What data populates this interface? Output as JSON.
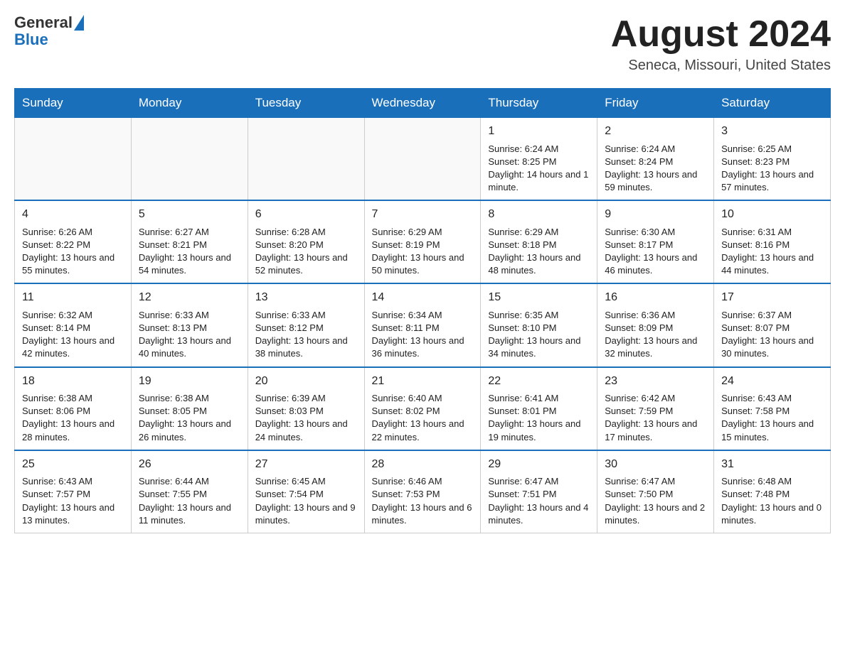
{
  "logo": {
    "text_general": "General",
    "text_blue": "Blue"
  },
  "header": {
    "month_year": "August 2024",
    "location": "Seneca, Missouri, United States"
  },
  "days_of_week": [
    "Sunday",
    "Monday",
    "Tuesday",
    "Wednesday",
    "Thursday",
    "Friday",
    "Saturday"
  ],
  "weeks": [
    {
      "days": [
        {
          "num": "",
          "info": ""
        },
        {
          "num": "",
          "info": ""
        },
        {
          "num": "",
          "info": ""
        },
        {
          "num": "",
          "info": ""
        },
        {
          "num": "1",
          "info": "Sunrise: 6:24 AM\nSunset: 8:25 PM\nDaylight: 14 hours and 1 minute."
        },
        {
          "num": "2",
          "info": "Sunrise: 6:24 AM\nSunset: 8:24 PM\nDaylight: 13 hours and 59 minutes."
        },
        {
          "num": "3",
          "info": "Sunrise: 6:25 AM\nSunset: 8:23 PM\nDaylight: 13 hours and 57 minutes."
        }
      ]
    },
    {
      "days": [
        {
          "num": "4",
          "info": "Sunrise: 6:26 AM\nSunset: 8:22 PM\nDaylight: 13 hours and 55 minutes."
        },
        {
          "num": "5",
          "info": "Sunrise: 6:27 AM\nSunset: 8:21 PM\nDaylight: 13 hours and 54 minutes."
        },
        {
          "num": "6",
          "info": "Sunrise: 6:28 AM\nSunset: 8:20 PM\nDaylight: 13 hours and 52 minutes."
        },
        {
          "num": "7",
          "info": "Sunrise: 6:29 AM\nSunset: 8:19 PM\nDaylight: 13 hours and 50 minutes."
        },
        {
          "num": "8",
          "info": "Sunrise: 6:29 AM\nSunset: 8:18 PM\nDaylight: 13 hours and 48 minutes."
        },
        {
          "num": "9",
          "info": "Sunrise: 6:30 AM\nSunset: 8:17 PM\nDaylight: 13 hours and 46 minutes."
        },
        {
          "num": "10",
          "info": "Sunrise: 6:31 AM\nSunset: 8:16 PM\nDaylight: 13 hours and 44 minutes."
        }
      ]
    },
    {
      "days": [
        {
          "num": "11",
          "info": "Sunrise: 6:32 AM\nSunset: 8:14 PM\nDaylight: 13 hours and 42 minutes."
        },
        {
          "num": "12",
          "info": "Sunrise: 6:33 AM\nSunset: 8:13 PM\nDaylight: 13 hours and 40 minutes."
        },
        {
          "num": "13",
          "info": "Sunrise: 6:33 AM\nSunset: 8:12 PM\nDaylight: 13 hours and 38 minutes."
        },
        {
          "num": "14",
          "info": "Sunrise: 6:34 AM\nSunset: 8:11 PM\nDaylight: 13 hours and 36 minutes."
        },
        {
          "num": "15",
          "info": "Sunrise: 6:35 AM\nSunset: 8:10 PM\nDaylight: 13 hours and 34 minutes."
        },
        {
          "num": "16",
          "info": "Sunrise: 6:36 AM\nSunset: 8:09 PM\nDaylight: 13 hours and 32 minutes."
        },
        {
          "num": "17",
          "info": "Sunrise: 6:37 AM\nSunset: 8:07 PM\nDaylight: 13 hours and 30 minutes."
        }
      ]
    },
    {
      "days": [
        {
          "num": "18",
          "info": "Sunrise: 6:38 AM\nSunset: 8:06 PM\nDaylight: 13 hours and 28 minutes."
        },
        {
          "num": "19",
          "info": "Sunrise: 6:38 AM\nSunset: 8:05 PM\nDaylight: 13 hours and 26 minutes."
        },
        {
          "num": "20",
          "info": "Sunrise: 6:39 AM\nSunset: 8:03 PM\nDaylight: 13 hours and 24 minutes."
        },
        {
          "num": "21",
          "info": "Sunrise: 6:40 AM\nSunset: 8:02 PM\nDaylight: 13 hours and 22 minutes."
        },
        {
          "num": "22",
          "info": "Sunrise: 6:41 AM\nSunset: 8:01 PM\nDaylight: 13 hours and 19 minutes."
        },
        {
          "num": "23",
          "info": "Sunrise: 6:42 AM\nSunset: 7:59 PM\nDaylight: 13 hours and 17 minutes."
        },
        {
          "num": "24",
          "info": "Sunrise: 6:43 AM\nSunset: 7:58 PM\nDaylight: 13 hours and 15 minutes."
        }
      ]
    },
    {
      "days": [
        {
          "num": "25",
          "info": "Sunrise: 6:43 AM\nSunset: 7:57 PM\nDaylight: 13 hours and 13 minutes."
        },
        {
          "num": "26",
          "info": "Sunrise: 6:44 AM\nSunset: 7:55 PM\nDaylight: 13 hours and 11 minutes."
        },
        {
          "num": "27",
          "info": "Sunrise: 6:45 AM\nSunset: 7:54 PM\nDaylight: 13 hours and 9 minutes."
        },
        {
          "num": "28",
          "info": "Sunrise: 6:46 AM\nSunset: 7:53 PM\nDaylight: 13 hours and 6 minutes."
        },
        {
          "num": "29",
          "info": "Sunrise: 6:47 AM\nSunset: 7:51 PM\nDaylight: 13 hours and 4 minutes."
        },
        {
          "num": "30",
          "info": "Sunrise: 6:47 AM\nSunset: 7:50 PM\nDaylight: 13 hours and 2 minutes."
        },
        {
          "num": "31",
          "info": "Sunrise: 6:48 AM\nSunset: 7:48 PM\nDaylight: 13 hours and 0 minutes."
        }
      ]
    }
  ]
}
